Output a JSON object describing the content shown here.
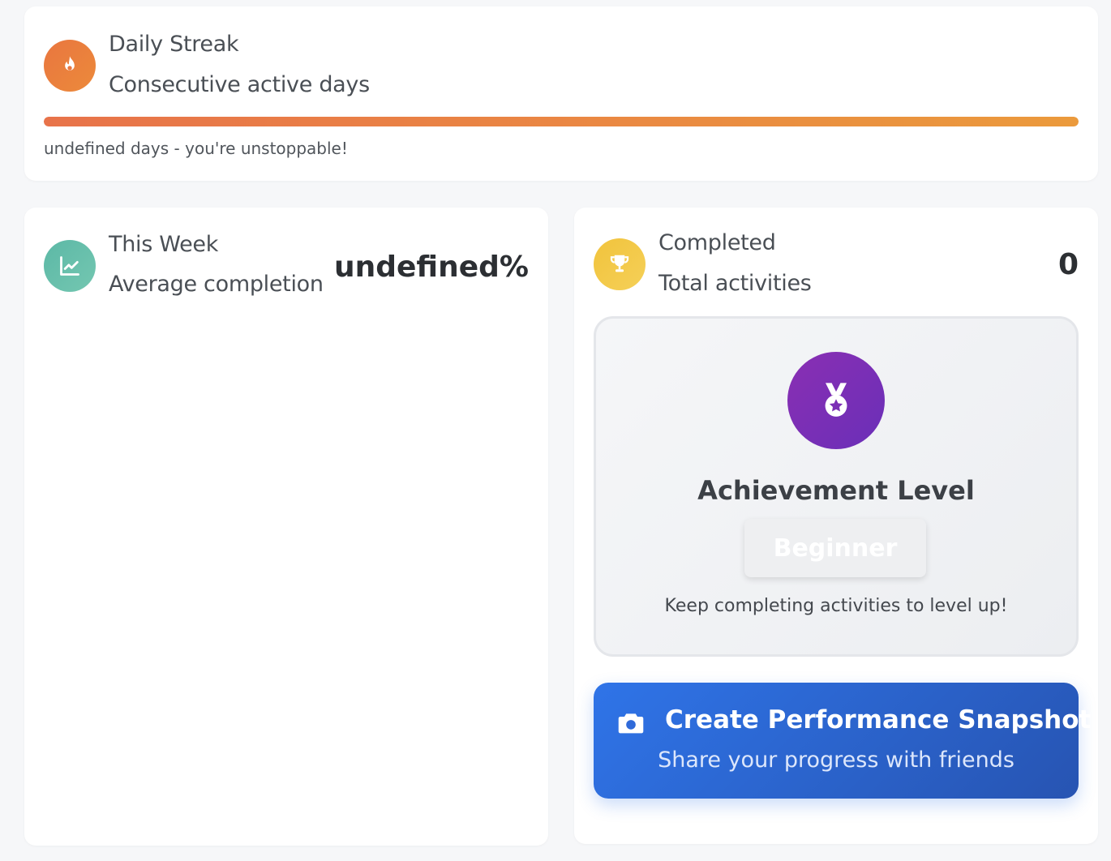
{
  "streak": {
    "title": "Daily Streak",
    "subtitle": "Consecutive active days",
    "message": "undefined days - you're unstoppable!",
    "progress_percent": 100,
    "icon": "flame-icon",
    "accent": "#e9763f"
  },
  "week": {
    "title": "This Week",
    "subtitle": "Average completion",
    "value": "undefined%",
    "icon": "chart-line-icon",
    "accent": "#5cb8a6"
  },
  "completed": {
    "title": "Completed",
    "subtitle": "Total activities",
    "value": "0",
    "icon": "trophy-icon",
    "accent": "#f1c33c"
  },
  "achievement": {
    "title": "Achievement Level",
    "level": "Beginner",
    "message": "Keep completing activities to level up!",
    "icon": "medal-icon",
    "accent": "#7b2fb5"
  },
  "snapshot": {
    "title": "Create Performance Snapshot",
    "subtitle": "Share your progress with friends",
    "icon": "camera-icon",
    "accent": "#2f74e8"
  }
}
